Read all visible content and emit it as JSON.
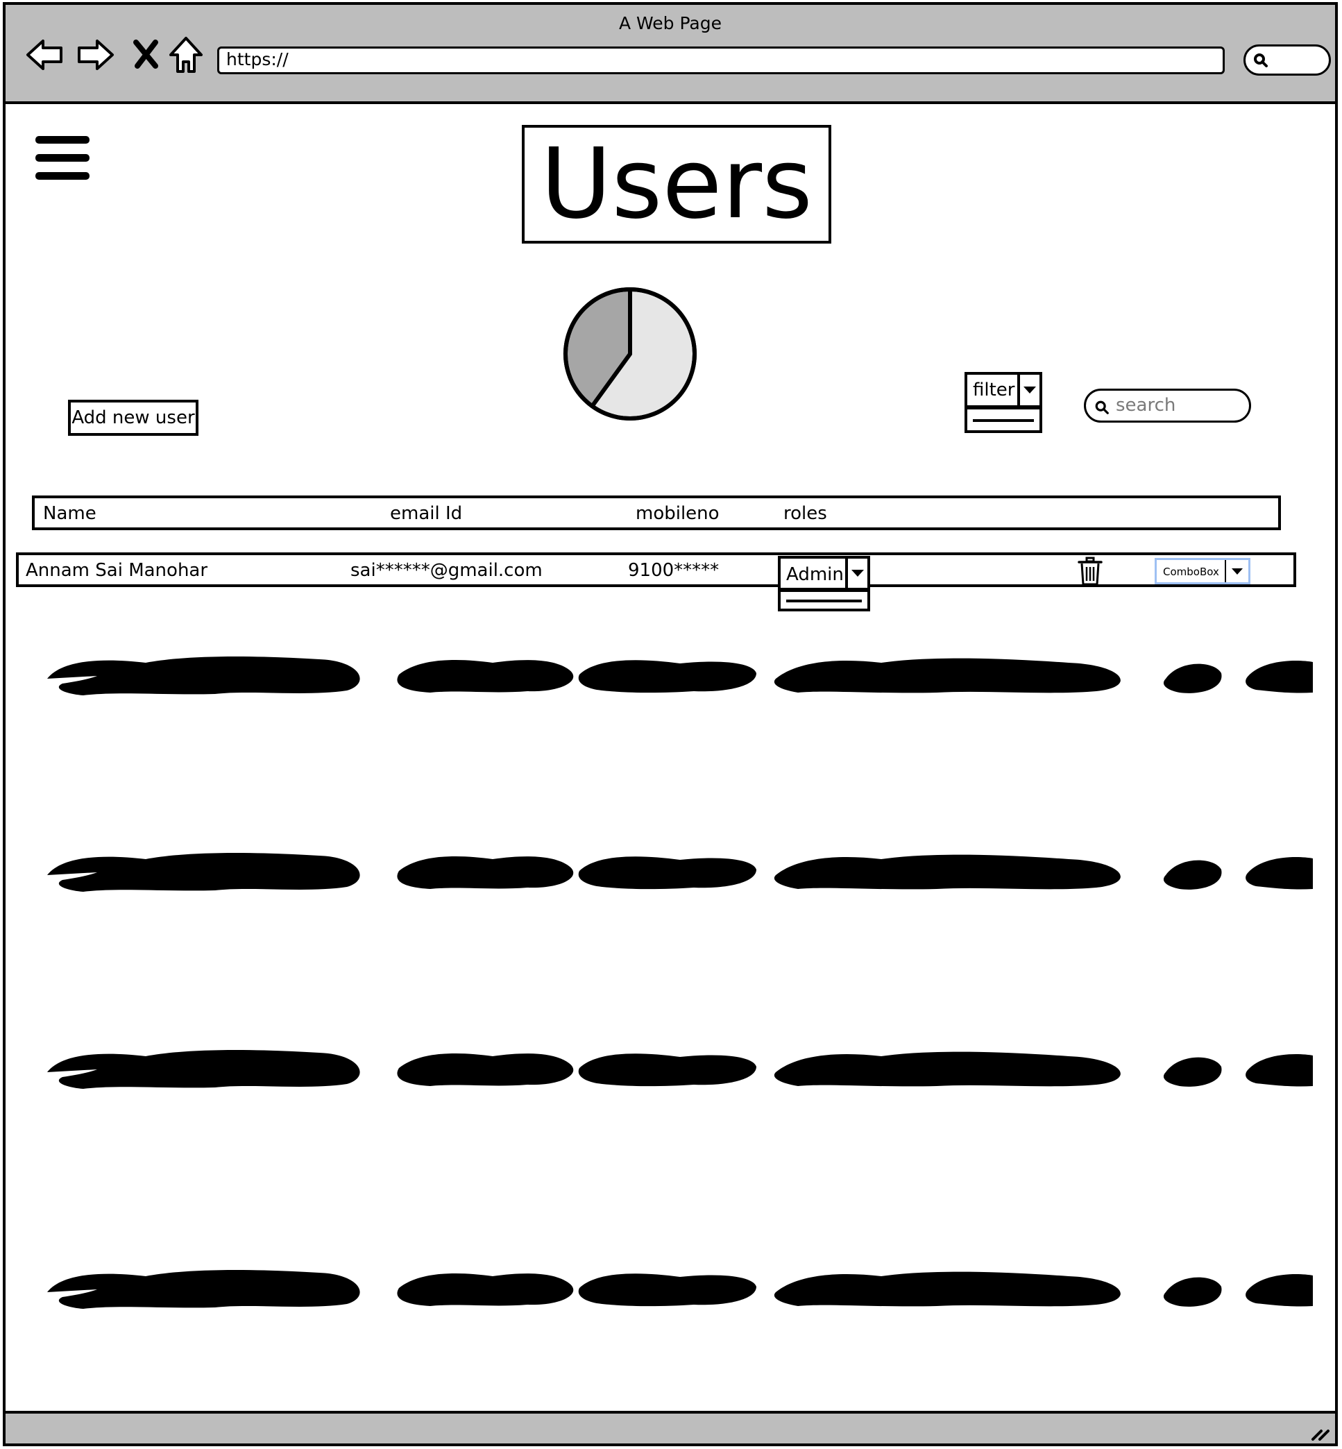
{
  "browser": {
    "title": "A Web Page",
    "url": "https://"
  },
  "page": {
    "heading": "Users",
    "add_user_label": "Add new user",
    "filter": {
      "label": "filter"
    },
    "search": {
      "placeholder": "search"
    }
  },
  "pie": {
    "slices": [
      {
        "fraction": 0.6,
        "color": "#e6e6e6"
      },
      {
        "fraction": 0.4,
        "color": "#a6a6a6"
      }
    ]
  },
  "table": {
    "headers": [
      "Name",
      "email Id",
      "mobileno",
      "roles"
    ],
    "rows": [
      {
        "name": "Annam Sai Manohar",
        "email": "sai******@gmail.com",
        "mobile": "9100*****",
        "role": "Admin",
        "extra_combo": "ComboBox"
      }
    ]
  },
  "colors": {
    "chrome": "#bdbdbd",
    "combo_highlight": "#9ec0f3"
  },
  "icons": [
    "back-icon",
    "forward-icon",
    "stop-icon",
    "home-icon",
    "search-icon",
    "hamburger-menu-icon",
    "trash-icon",
    "chevron-down-icon",
    "resize-grip-icon"
  ]
}
